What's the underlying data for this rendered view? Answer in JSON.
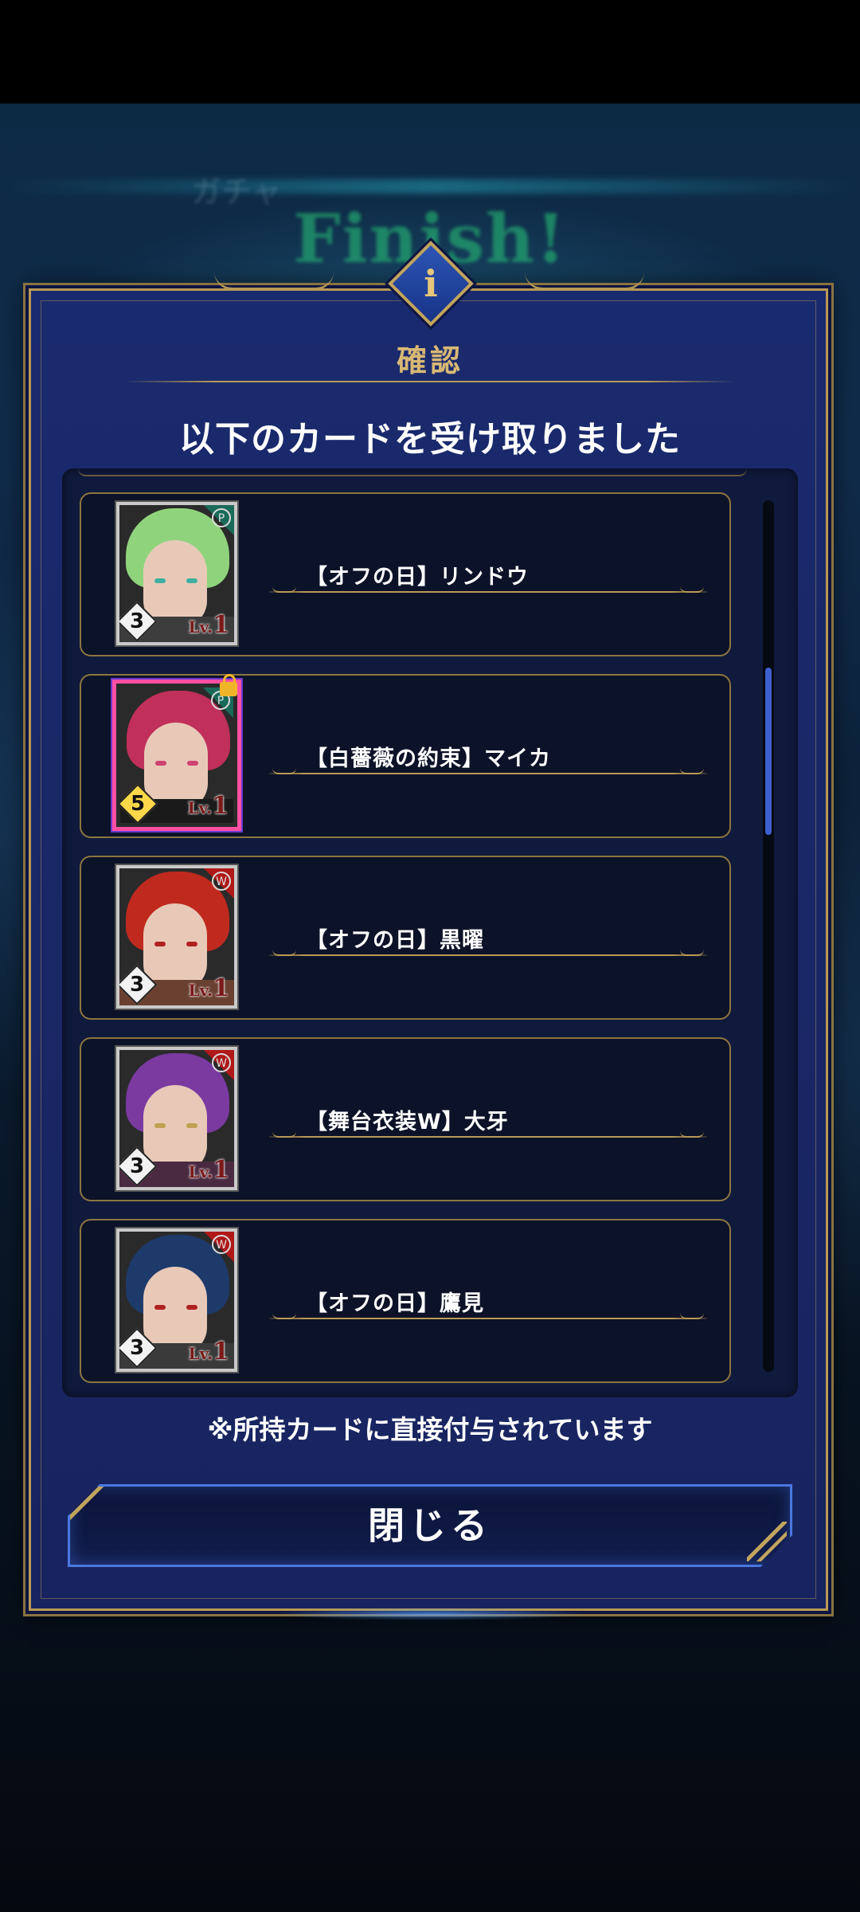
{
  "background": {
    "finish_text": "Finish!",
    "ghost_text": "ガチャ"
  },
  "dialog": {
    "icon": "info-icon",
    "icon_letter": "i",
    "title": "確認",
    "subtitle": "以下のカードを受け取りました",
    "note": "※所持カードに直接付与されています",
    "close_label": "閉じる"
  },
  "cards": [
    {
      "name": "【オフの日】リンドウ",
      "rank": "3",
      "level_prefix": "Lv.",
      "level": "1",
      "locked": false,
      "badge": "P",
      "hair": "#8fd47c",
      "shirt": "#3c3c3c",
      "eyes": "#3fb0a0",
      "rainbow": false
    },
    {
      "name": "【白薔薇の約束】マイカ",
      "rank": "5",
      "level_prefix": "Lv.",
      "level": "1",
      "locked": true,
      "badge": "P",
      "hair": "#c0305a",
      "shirt": "#1a1a1a",
      "eyes": "#d04070",
      "rainbow": true
    },
    {
      "name": "【オフの日】黒曜",
      "rank": "3",
      "level_prefix": "Lv.",
      "level": "1",
      "locked": false,
      "badge": "W",
      "hair": "#c02a1e",
      "shirt": "#6a4030",
      "eyes": "#b02020",
      "rainbow": false
    },
    {
      "name": "【舞台衣装W】大牙",
      "rank": "3",
      "level_prefix": "Lv.",
      "level": "1",
      "locked": false,
      "badge": "W",
      "hair": "#7a3aa0",
      "shirt": "#4a2a40",
      "eyes": "#c0a050",
      "rainbow": false
    },
    {
      "name": "【オフの日】鷹見",
      "rank": "3",
      "level_prefix": "Lv.",
      "level": "1",
      "locked": false,
      "badge": "W",
      "hair": "#1e3a6a",
      "shirt": "#3a3a3a",
      "eyes": "#b02020",
      "rainbow": false
    }
  ],
  "colors": {
    "gold": "#b89a55",
    "panel": "#1a2a6e",
    "accent_blue": "#3d5fd0"
  }
}
